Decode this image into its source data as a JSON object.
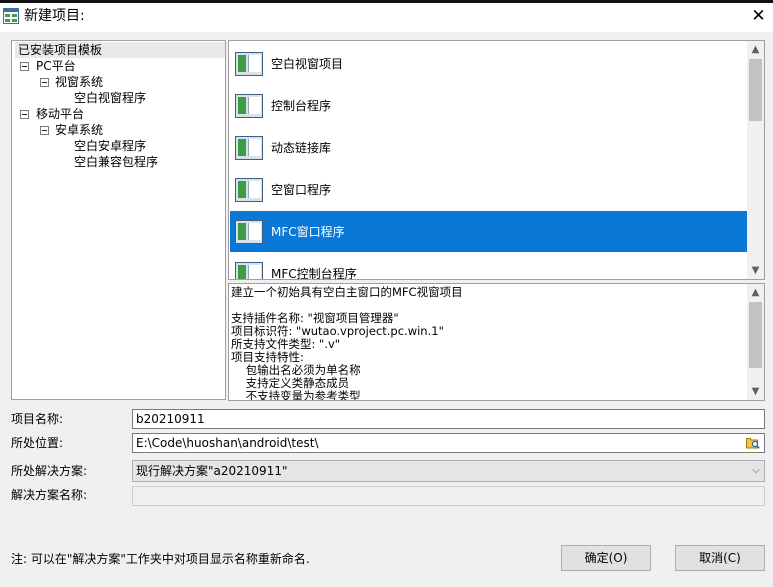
{
  "window": {
    "title": "新建项目:",
    "close_glyph": "✕",
    "icon": "new-project-window-icon"
  },
  "templates_tree": {
    "root_label": "已安装项目模板",
    "nodes": [
      {
        "label": "PC平台",
        "expanded": true,
        "collapse_glyph": "⊟"
      },
      {
        "label": "视窗系统",
        "expanded": true,
        "collapse_glyph": "⊟"
      },
      {
        "label": "空白视窗程序"
      },
      {
        "label": "移动平台",
        "expanded": true,
        "collapse_glyph": "⊟"
      },
      {
        "label": "安卓系统",
        "expanded": true,
        "collapse_glyph": "⊟"
      },
      {
        "label": "空白安卓程序"
      },
      {
        "label": "空白兼容包程序"
      }
    ]
  },
  "project_list": {
    "items": [
      {
        "label": "空白视窗项目",
        "icon": "window-app-icon"
      },
      {
        "label": "控制台程序",
        "icon": "window-app-icon"
      },
      {
        "label": "动态链接库",
        "icon": "window-app-icon"
      },
      {
        "label": "空窗口程序",
        "icon": "window-app-icon"
      },
      {
        "label": "MFC窗口程序",
        "icon": "window-app-icon",
        "selected": true
      },
      {
        "label": "MFC控制台程序",
        "icon": "window-app-icon"
      }
    ],
    "scroll_up_glyph": "▲",
    "scroll_down_glyph": "▼"
  },
  "description": {
    "lines": [
      "建立一个初始具有空白主窗口的MFC视窗项目",
      "",
      "支持插件名称: \"视窗项目管理器\"",
      "项目标识符: \"wutao.vproject.pc.win.1\"",
      "所支持文件类型: \".v\"",
      "项目支持特性:",
      "    包输出名必须为单名称",
      "    支持定义类静态成员",
      "    不支持变量为参考类型"
    ]
  },
  "form": {
    "project_name_label": "项目名称:",
    "project_name_value": "b20210911",
    "location_label": "所处位置:",
    "location_value": "E:\\Code\\huoshan\\android\\test\\",
    "location_browse_icon": "folder-browse-icon",
    "solution_label": "所处解决方案:",
    "solution_value": "现行解决方案\"a20210911\"",
    "solution_dropdown_glyph": "⌵",
    "solution_name_label": "解决方案名称:",
    "solution_name_value": ""
  },
  "footer": {
    "note": "注: 可以在\"解决方案\"工作夹中对项目显示名称重新命名.",
    "ok_label": "确定(O)",
    "cancel_label": "取消(C)"
  },
  "colors": {
    "selection": "#0a78d4",
    "window_bg": "#f0f0f0",
    "tree_selection": "#e9e9e9"
  }
}
